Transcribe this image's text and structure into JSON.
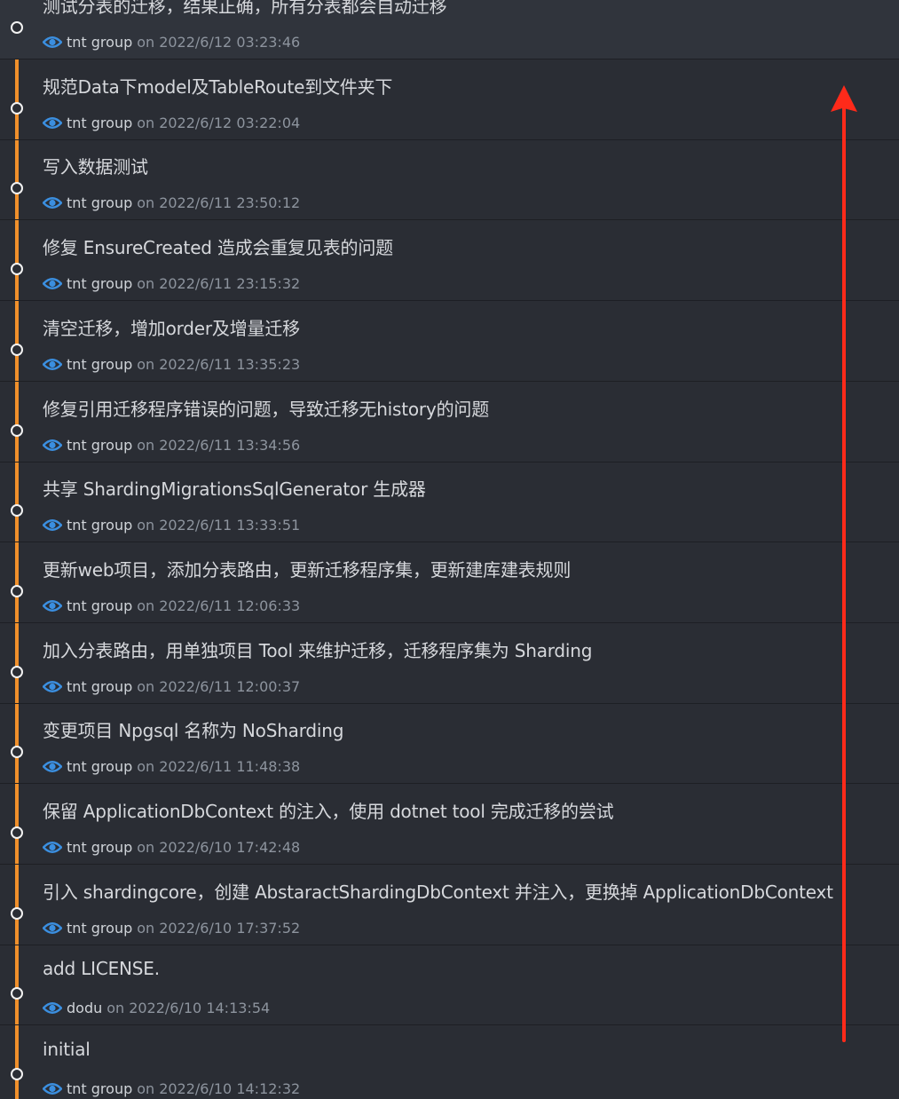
{
  "commits": [
    {
      "message": "测试分表的迁移，结果正确，所有分表都会自动迁移",
      "author": "tnt group",
      "on": "on",
      "date": "2022/6/12 03:23:46"
    },
    {
      "message": "规范Data下model及TableRoute到文件夹下",
      "author": "tnt group",
      "on": "on",
      "date": "2022/6/12 03:22:04"
    },
    {
      "message": "写入数据测试",
      "author": "tnt group",
      "on": "on",
      "date": "2022/6/11 23:50:12"
    },
    {
      "message": "修复 EnsureCreated 造成会重复见表的问题",
      "author": "tnt group",
      "on": "on",
      "date": "2022/6/11 23:15:32"
    },
    {
      "message": "清空迁移，增加order及增量迁移",
      "author": "tnt group",
      "on": "on",
      "date": "2022/6/11 13:35:23"
    },
    {
      "message": "修复引用迁移程序错误的问题，导致迁移无history的问题",
      "author": "tnt group",
      "on": "on",
      "date": "2022/6/11 13:34:56"
    },
    {
      "message": "共享 ShardingMigrationsSqlGenerator 生成器",
      "author": "tnt group",
      "on": "on",
      "date": "2022/6/11 13:33:51"
    },
    {
      "message": "更新web项目，添加分表路由，更新迁移程序集，更新建库建表规则",
      "author": "tnt group",
      "on": "on",
      "date": "2022/6/11 12:06:33"
    },
    {
      "message": "加入分表路由，用单独项目 Tool 来维护迁移，迁移程序集为 Sharding",
      "author": "tnt group",
      "on": "on",
      "date": "2022/6/11 12:00:37"
    },
    {
      "message": "变更项目 Npgsql 名称为 NoSharding",
      "author": "tnt group",
      "on": "on",
      "date": "2022/6/11 11:48:38"
    },
    {
      "message": "保留 ApplicationDbContext 的注入，使用 dotnet tool 完成迁移的尝试",
      "author": "tnt group",
      "on": "on",
      "date": "2022/6/10 17:42:48"
    },
    {
      "message": "引入 shardingcore，创建 AbstaractShardingDbContext 并注入，更换掉 ApplicationDbContext",
      "author": "tnt group",
      "on": "on",
      "date": "2022/6/10 17:37:52"
    },
    {
      "message": "add LICENSE.",
      "author": "dodu",
      "on": "on",
      "date": "2022/6/10 14:13:54"
    },
    {
      "message": "initial",
      "author": "tnt group",
      "on": "on",
      "date": "2022/6/10 14:12:32"
    }
  ],
  "colors": {
    "background": "#2a2d34",
    "timeline": "#f0902b",
    "eye_icon": "#3b8fe0",
    "arrow": "#ff2a1a"
  }
}
